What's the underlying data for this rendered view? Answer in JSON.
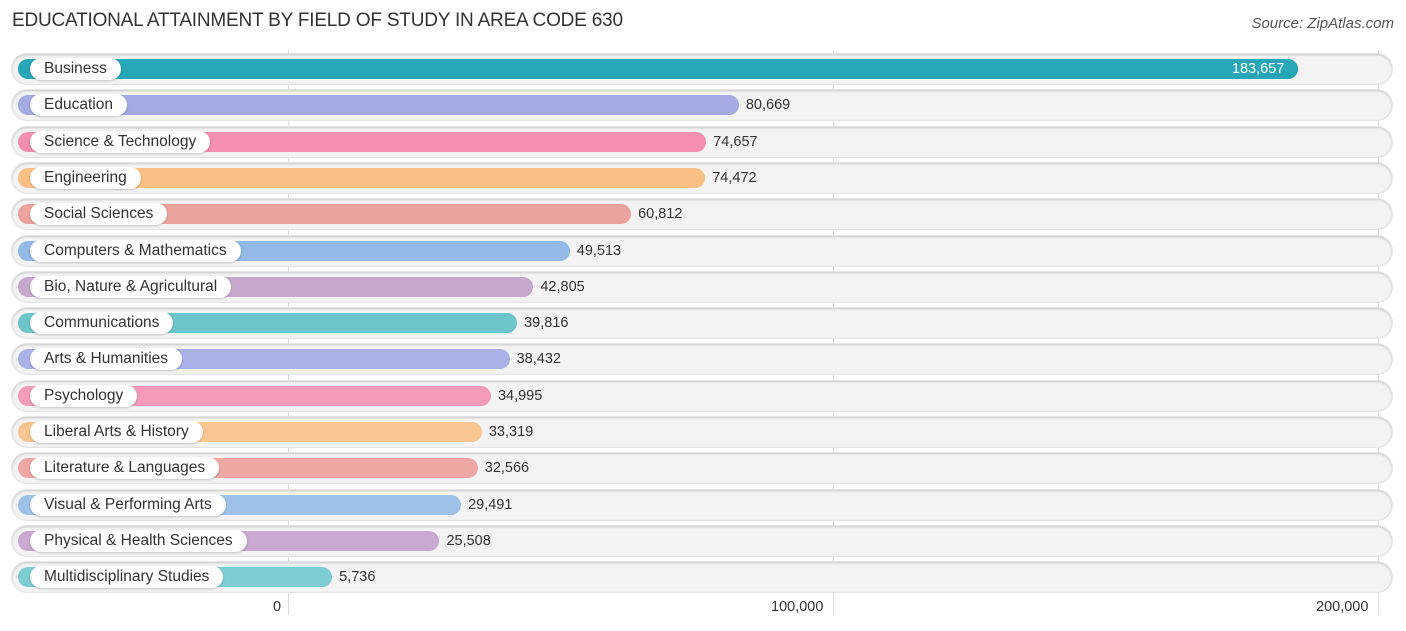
{
  "chart_data": {
    "type": "bar",
    "orientation": "horizontal",
    "title": "EDUCATIONAL ATTAINMENT BY FIELD OF STUDY IN AREA CODE 630",
    "source": "Source: ZipAtlas.com",
    "xlabel": "",
    "ylabel": "",
    "xlim": [
      0,
      200000
    ],
    "x_ticks": [
      "0",
      "100,000",
      "200,000"
    ],
    "grid": true,
    "categories": [
      "Business",
      "Education",
      "Science & Technology",
      "Engineering",
      "Social Sciences",
      "Computers & Mathematics",
      "Bio, Nature & Agricultural",
      "Communications",
      "Arts & Humanities",
      "Psychology",
      "Liberal Arts & History",
      "Literature & Languages",
      "Visual & Performing Arts",
      "Physical & Health Sciences",
      "Multidisciplinary Studies"
    ],
    "values": [
      183657,
      80669,
      74657,
      74472,
      60812,
      49513,
      42805,
      39816,
      38432,
      34995,
      33319,
      32566,
      29491,
      25508,
      5736
    ],
    "value_labels": [
      "183,657",
      "80,669",
      "74,657",
      "74,472",
      "60,812",
      "49,513",
      "42,805",
      "39,816",
      "38,432",
      "34,995",
      "33,319",
      "32,566",
      "29,491",
      "25,508",
      "5,736"
    ],
    "colors": [
      "#26a6b6",
      "#a3abe2",
      "#f48fb1",
      "#f9bf85",
      "#eba29d",
      "#93b9e6",
      "#c6a8cc",
      "#6dc5cc",
      "#aab1e6",
      "#f59ab8",
      "#f9c593",
      "#eea7a3",
      "#9ec1e8",
      "#c9a9cf",
      "#7ecdd3"
    ]
  }
}
